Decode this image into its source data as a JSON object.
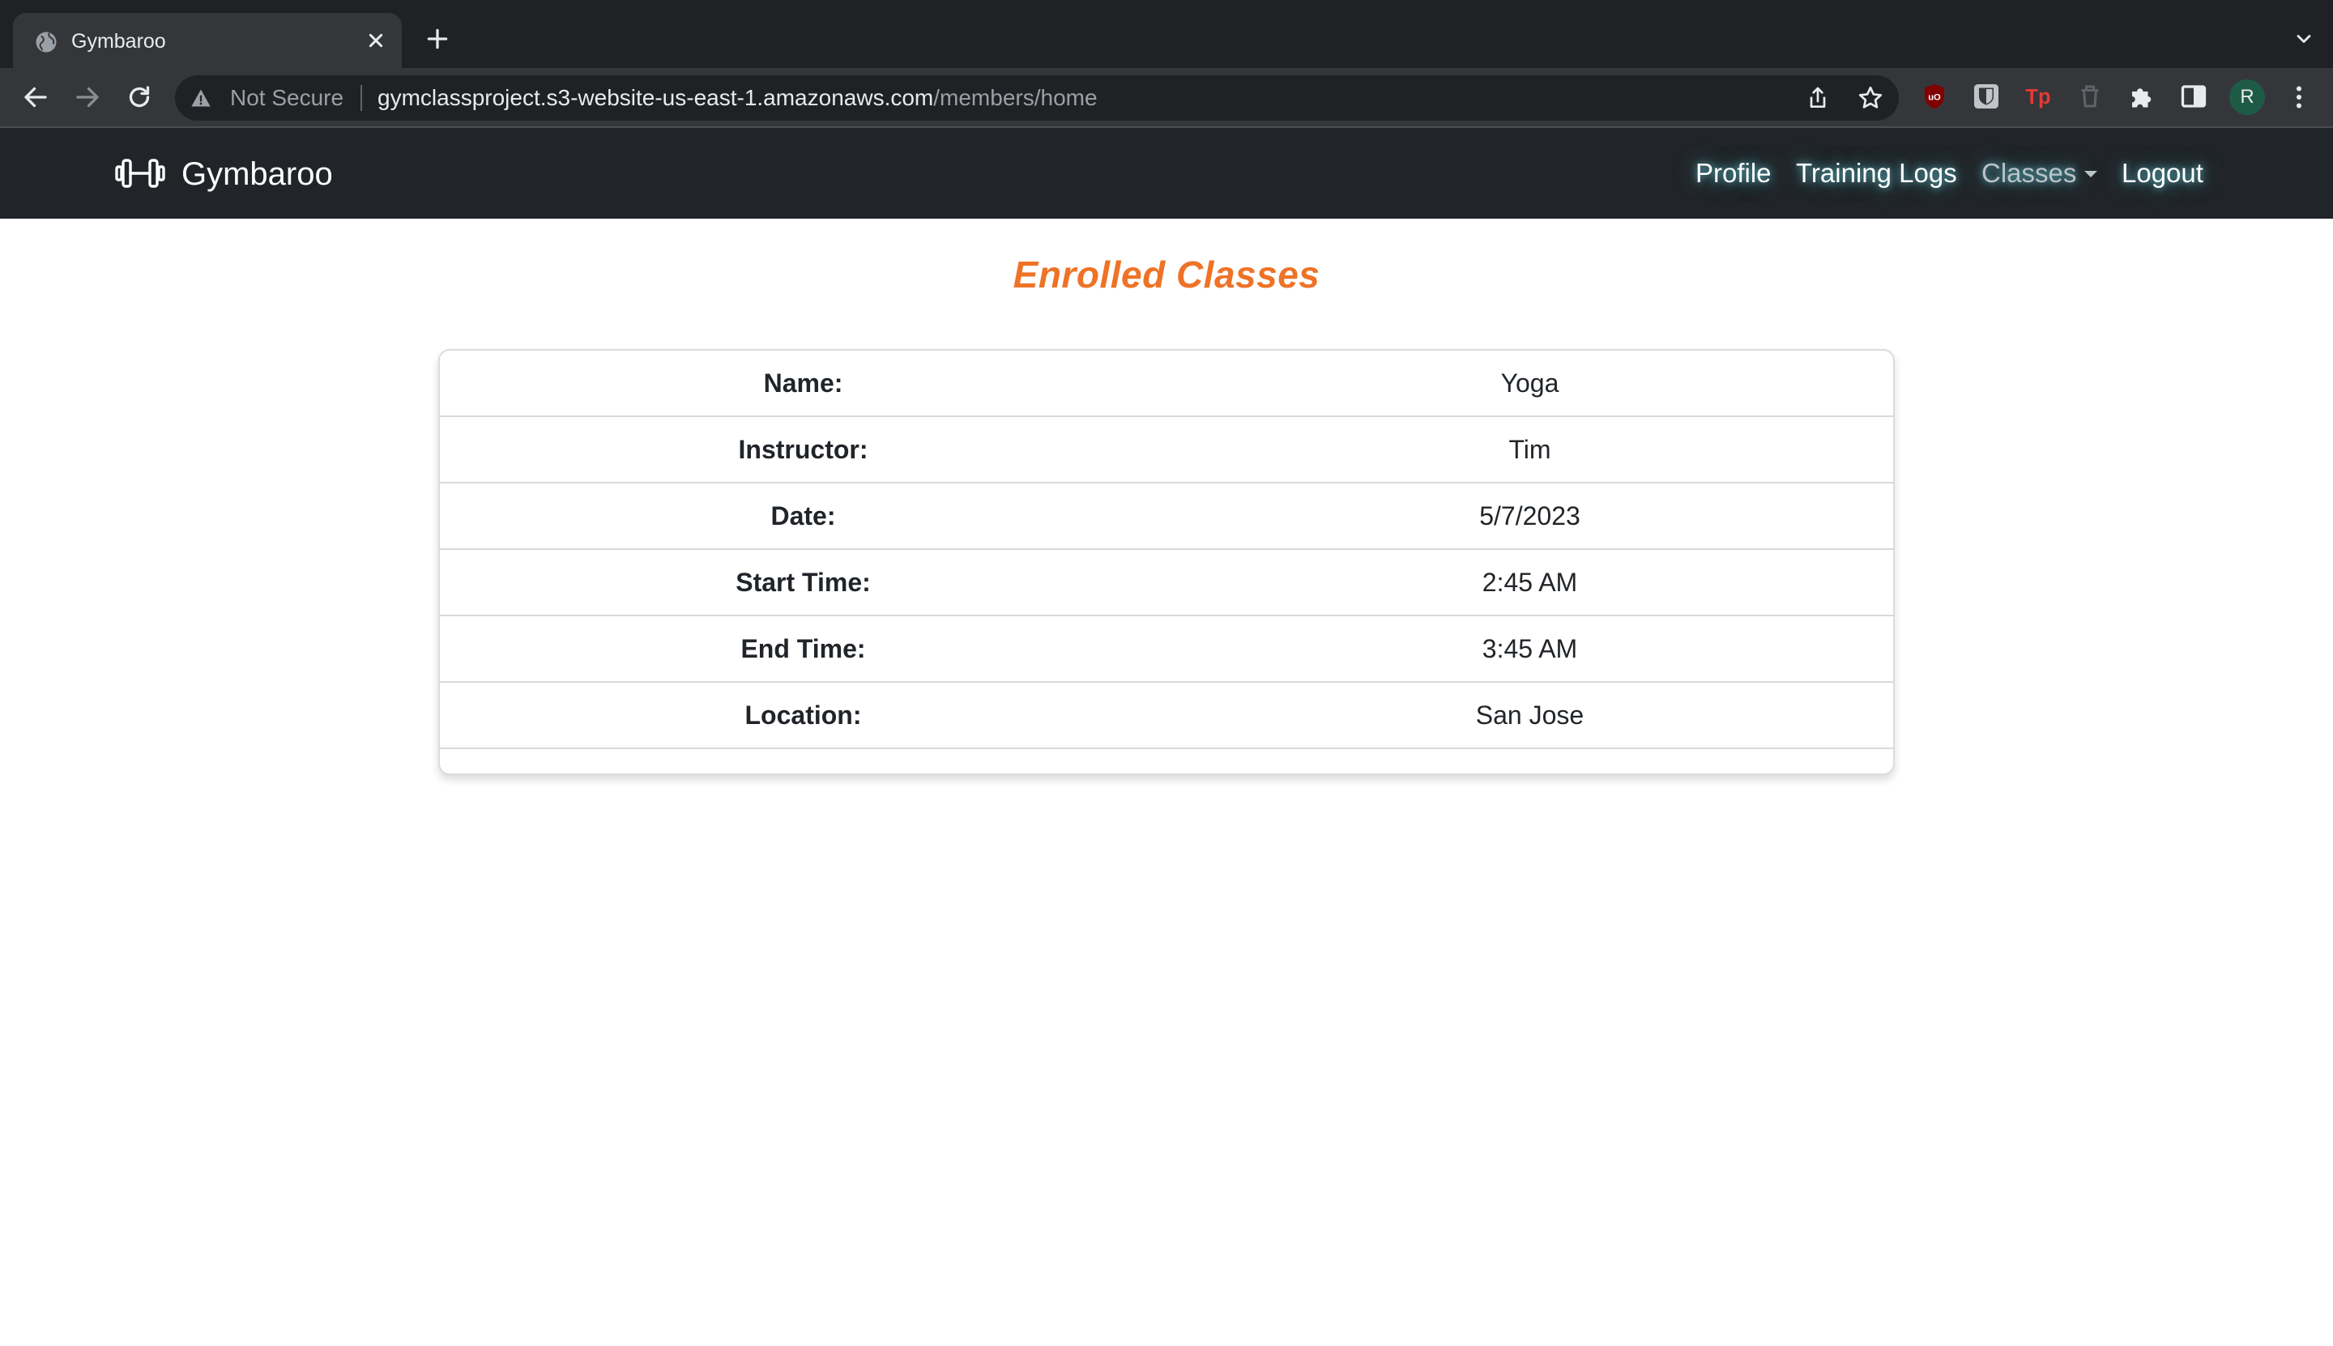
{
  "browser": {
    "tab": {
      "title": "Gymbaroo"
    },
    "toolbar": {
      "security_label": "Not Secure",
      "url_host": "gymclassproject.s3-website-us-east-1.amazonaws.com",
      "url_path": "/members/home",
      "profile_initial": "R"
    },
    "icons": [
      "globe-icon",
      "close-icon",
      "plus-icon",
      "chevron-down-icon",
      "back-icon",
      "forward-icon",
      "reload-icon",
      "warning-icon",
      "share-icon",
      "star-icon",
      "ublock-icon",
      "bitwarden-icon",
      "tp-icon",
      "trash-icon",
      "puzzle-icon",
      "sidebar-icon",
      "more-icon"
    ]
  },
  "navbar": {
    "brand": "Gymbaroo",
    "links": {
      "profile": "Profile",
      "training_logs": "Training Logs",
      "classes": "Classes",
      "logout": "Logout"
    }
  },
  "main": {
    "title": "Enrolled Classes",
    "details": [
      {
        "label": "Name:",
        "value": "Yoga"
      },
      {
        "label": "Instructor:",
        "value": "Tim"
      },
      {
        "label": "Date:",
        "value": "5/7/2023"
      },
      {
        "label": "Start Time:",
        "value": "2:45 AM"
      },
      {
        "label": "End Time:",
        "value": "3:45 AM"
      },
      {
        "label": "Location:",
        "value": "San Jose"
      }
    ]
  },
  "colors": {
    "accent": "#ee7326",
    "navbar_bg": "#212529",
    "chrome_dark": "#202124",
    "chrome_toolbar": "#35363a"
  }
}
